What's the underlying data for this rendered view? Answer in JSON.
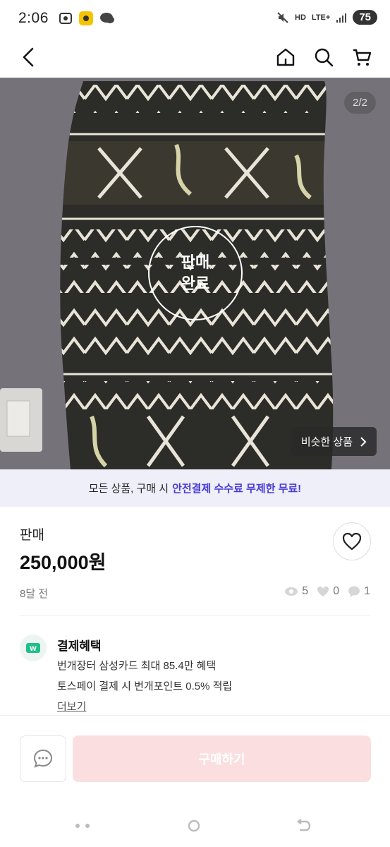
{
  "status_bar": {
    "time": "2:06",
    "network": "LTE+",
    "hd": "HD",
    "battery": "75"
  },
  "nav": {
    "back_icon": "arrow-left-icon",
    "home_icon": "home-icon",
    "search_icon": "search-icon",
    "cart_icon": "cart-icon"
  },
  "image": {
    "counter": "2/2",
    "sold_line1": "판매",
    "sold_line2": "완료",
    "similar_label": "비슷한 상품"
  },
  "promo": {
    "text": "모든 상품, 구매 시",
    "highlight": "안전결제 수수료 무제한 무료!"
  },
  "product": {
    "status": "판매",
    "price": "250,000원",
    "time_ago": "8달 전",
    "views": "5",
    "likes": "0",
    "chats": "1"
  },
  "benefits": {
    "title": "결제혜택",
    "line1": "번개장터 삼성카드 최대 85.4만 혜택",
    "line2": "토스페이 결제 시 번개포인트 0.5% 적립",
    "more": "더보기"
  },
  "actions": {
    "buy": "구매하기"
  },
  "colors": {
    "accent": "#4a3bd6",
    "buy_disabled": "#fbdfe0",
    "promo_bg": "#eeeff8"
  }
}
